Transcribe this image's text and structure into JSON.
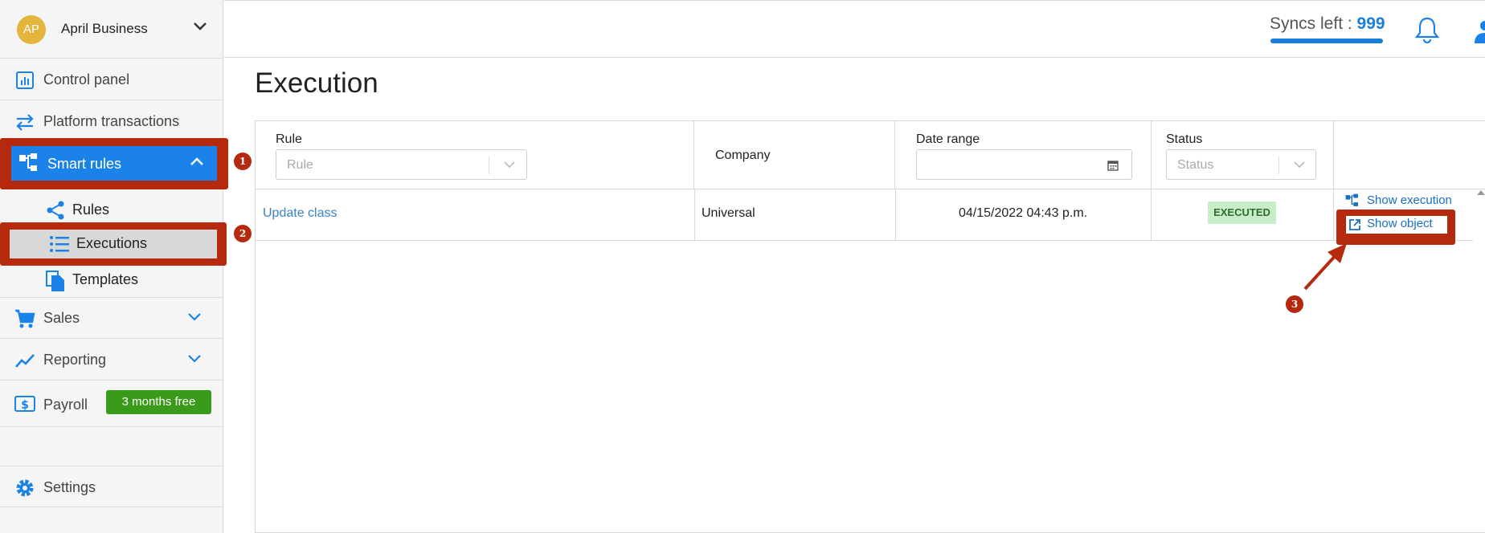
{
  "sidebar": {
    "org": {
      "initials": "AP",
      "name": "April Business"
    },
    "items": [
      {
        "label": "Control panel",
        "icon": "dashboard-icon"
      },
      {
        "label": "Platform transactions",
        "icon": "transfer-icon"
      },
      {
        "label": "Smart rules",
        "icon": "flowchart-icon"
      },
      {
        "label": "Sales",
        "icon": "cart-icon"
      },
      {
        "label": "Reporting",
        "icon": "trend-icon"
      },
      {
        "label": "Payroll",
        "icon": "dollar-icon",
        "badge": "3 months free"
      },
      {
        "label": "Settings",
        "icon": "gear-icon"
      }
    ],
    "subitems": [
      {
        "label": "Rules",
        "icon": "share-icon"
      },
      {
        "label": "Executions",
        "icon": "list-icon"
      },
      {
        "label": "Templates",
        "icon": "document-icon"
      }
    ]
  },
  "header": {
    "syncs_label": "Syncs left :",
    "syncs_value": "999"
  },
  "page": {
    "title": "Execution"
  },
  "table": {
    "headers": {
      "rule": "Rule",
      "rule_placeholder": "Rule",
      "company": "Company",
      "date_range": "Date range",
      "status": "Status",
      "status_placeholder": "Status"
    },
    "rows": [
      {
        "rule": "Update class",
        "company": "Universal",
        "date": "04/15/2022 04:43 p.m.",
        "status": "EXECUTED",
        "action_execution": "Show execution",
        "action_object": "Show object"
      }
    ]
  },
  "annotations": {
    "m1": "1",
    "m2": "2",
    "m3": "3"
  },
  "colors": {
    "accent": "#1a82e8",
    "highlight": "#b52a0f",
    "free_badge": "#3a9a1a",
    "executed_bg": "#c9ecc9"
  }
}
